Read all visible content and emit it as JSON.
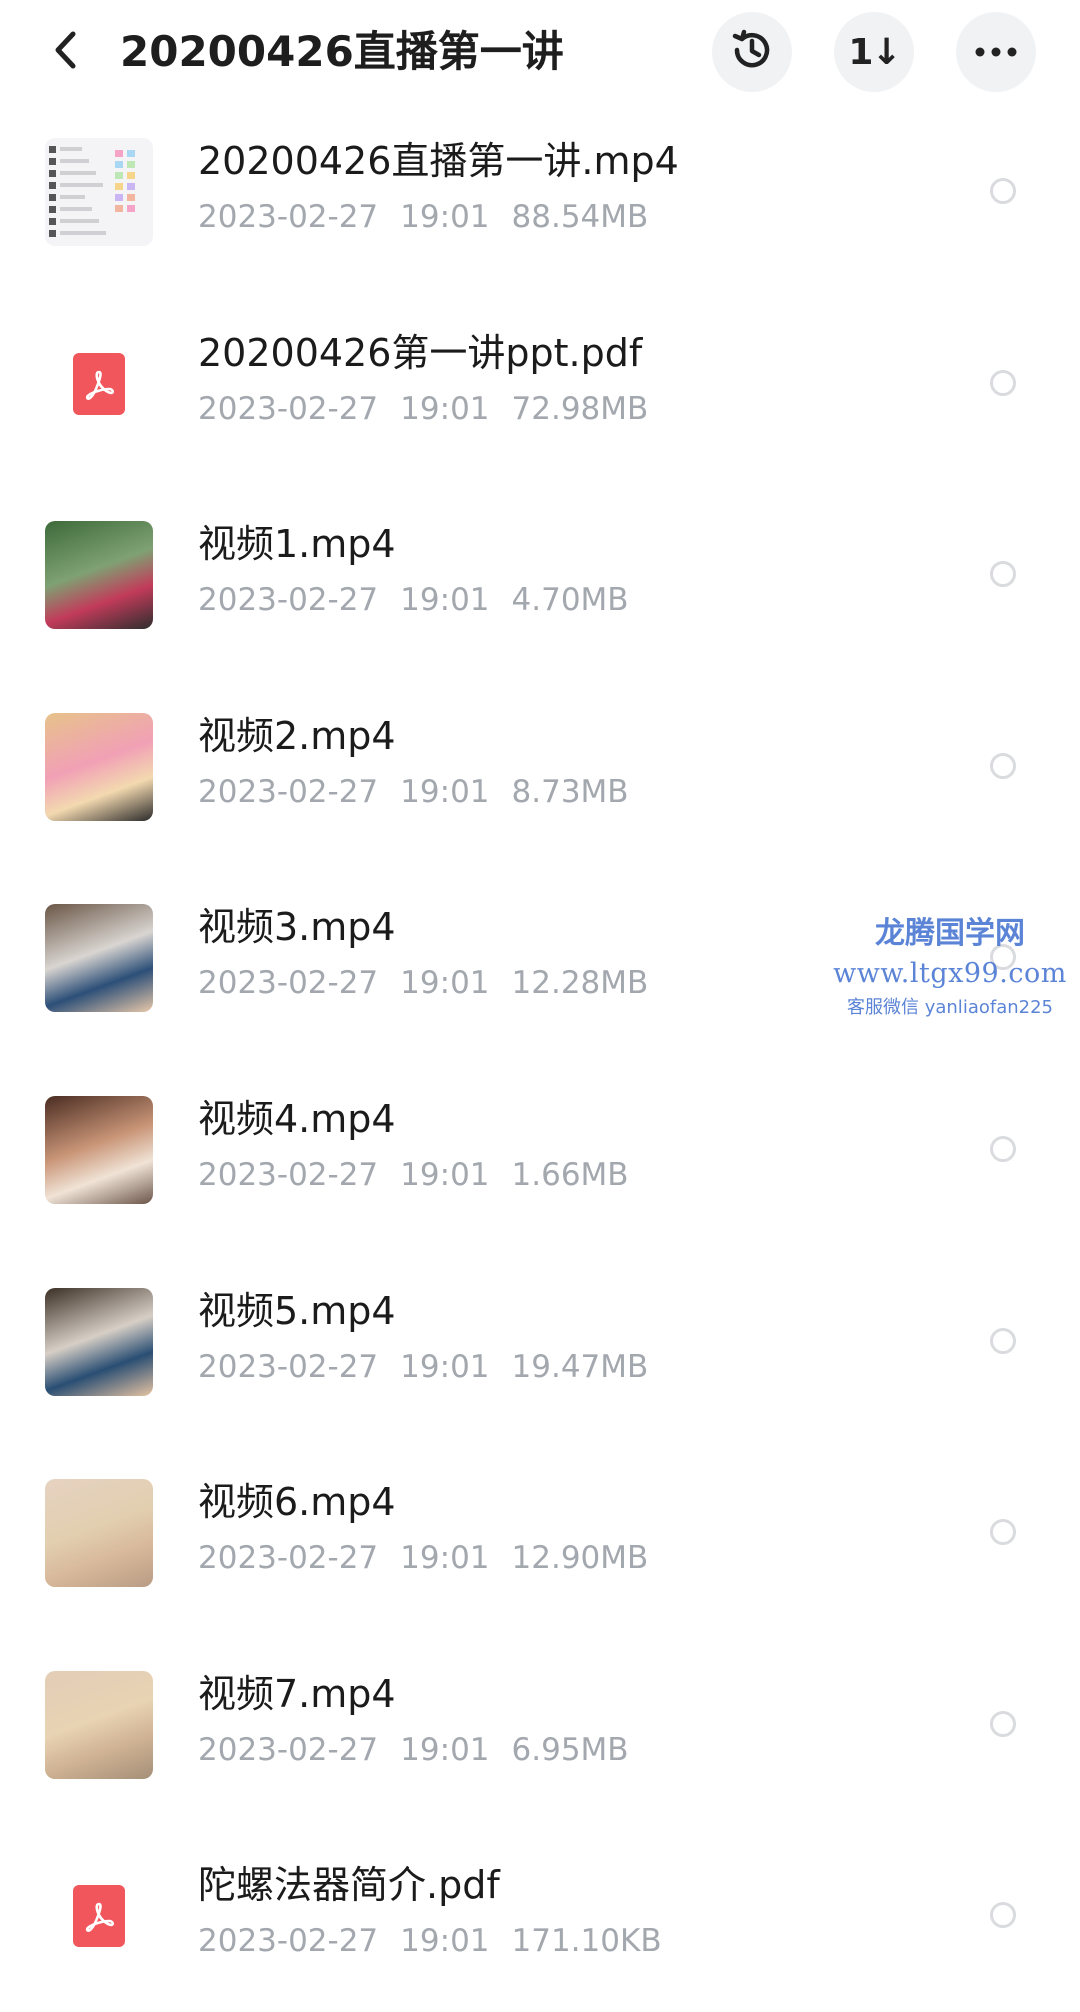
{
  "header": {
    "title": "20200426直播第一讲",
    "back_icon": "chevron-left-icon",
    "history_icon": "history-icon",
    "sort_icon": "sort-icon",
    "sort_glyph": "1↓",
    "more_icon": "more-icon"
  },
  "files": [
    {
      "name": "20200426直播第一讲.mp4",
      "date": "2023-02-27",
      "time": "19:01",
      "size": "88.54MB",
      "thumb": "chat-screenshot"
    },
    {
      "name": "20200426第一讲ppt.pdf",
      "date": "2023-02-27",
      "time": "19:01",
      "size": "72.98MB",
      "thumb": "pdf-icon"
    },
    {
      "name": "视频1.mp4",
      "date": "2023-02-27",
      "time": "19:01",
      "size": "4.70MB",
      "thumb": "video-thumbnail"
    },
    {
      "name": "视频2.mp4",
      "date": "2023-02-27",
      "time": "19:01",
      "size": "8.73MB",
      "thumb": "video-thumbnail"
    },
    {
      "name": "视频3.mp4",
      "date": "2023-02-27",
      "time": "19:01",
      "size": "12.28MB",
      "thumb": "video-thumbnail"
    },
    {
      "name": "视频4.mp4",
      "date": "2023-02-27",
      "time": "19:01",
      "size": "1.66MB",
      "thumb": "video-thumbnail"
    },
    {
      "name": "视频5.mp4",
      "date": "2023-02-27",
      "time": "19:01",
      "size": "19.47MB",
      "thumb": "video-thumbnail"
    },
    {
      "name": "视频6.mp4",
      "date": "2023-02-27",
      "time": "19:01",
      "size": "12.90MB",
      "thumb": "video-thumbnail"
    },
    {
      "name": "视频7.mp4",
      "date": "2023-02-27",
      "time": "19:01",
      "size": "6.95MB",
      "thumb": "video-thumbnail"
    },
    {
      "name": "陀螺法器简介.pdf",
      "date": "2023-02-27",
      "time": "19:01",
      "size": "171.10KB",
      "thumb": "pdf-icon"
    }
  ],
  "watermark": {
    "line1": "龙腾国学网",
    "line2": "www.ltgx99.com",
    "line3": "客服微信 yanliaofan225"
  },
  "colors": {
    "title_text": "#1e1e1e",
    "meta_text": "#a3a7ae",
    "pdf_red": "#f0565b",
    "header_button_bg": "#f1f2f4",
    "radio_border": "#d9dbde",
    "watermark_blue": "#3f6fcf"
  }
}
